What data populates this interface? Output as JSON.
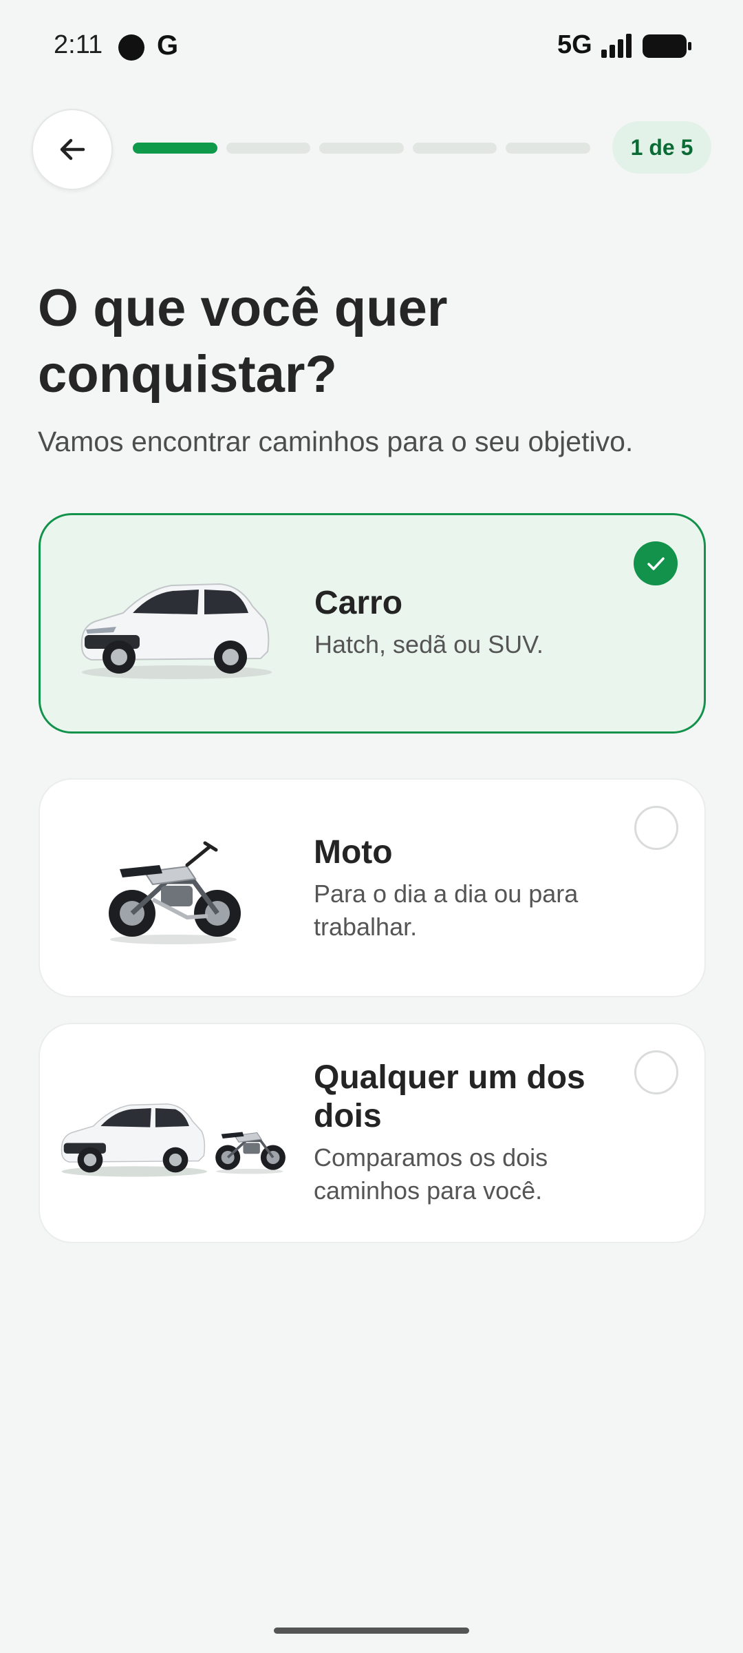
{
  "status_bar": {
    "time": "2:11",
    "g_label": "G",
    "network": "5G"
  },
  "nav": {
    "back_icon": "arrow-left-icon",
    "progress": {
      "current_step": 1,
      "total_steps": 5
    },
    "step_label": "1 de 5"
  },
  "header": {
    "title": "O que você quer conquistar?",
    "subtitle": "Vamos encontrar caminhos para o seu objetivo."
  },
  "options": [
    {
      "title": "Carro",
      "description": "Hatch, sedã ou SUV.",
      "selected": true,
      "image": "car-image"
    },
    {
      "title": "Moto",
      "description": "Para o dia a dia ou para trabalhar.",
      "selected": false,
      "image": "motorcycle-image"
    },
    {
      "title": "Qualquer um dos dois",
      "description": "Comparamos os dois caminhos para você.",
      "selected": false,
      "image": "car-and-motorcycle-image"
    }
  ],
  "colors": {
    "accent": "#12924a",
    "selected_bg": "#eaf5ee",
    "step_pill_bg": "#e3f2e8",
    "background": "#f4f6f5"
  }
}
